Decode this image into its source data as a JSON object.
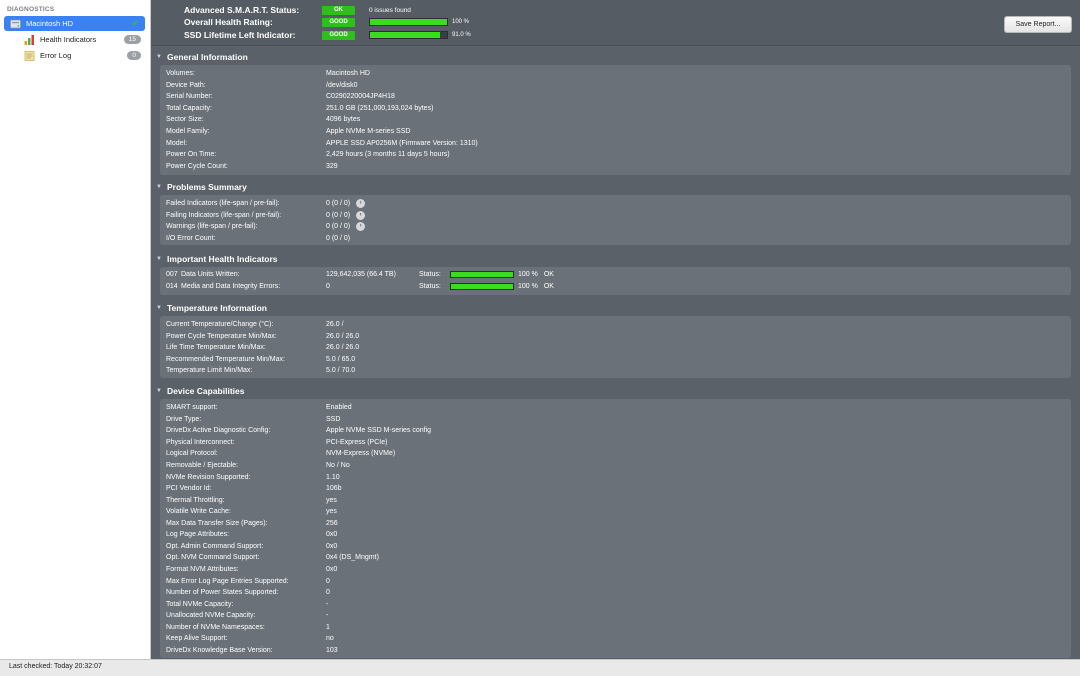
{
  "sidebar": {
    "heading": "DIAGNOSTICS",
    "items": [
      {
        "label": "Macintosh HD",
        "icon": "disk-icon",
        "selected": true
      },
      {
        "label": "Health Indicators",
        "icon": "bar-chart-icon",
        "count": "15"
      },
      {
        "label": "Error Log",
        "icon": "log-icon",
        "count": "0"
      }
    ]
  },
  "header": {
    "smart_label": "Advanced S.M.A.R.T. Status:",
    "smart_badge": "OK",
    "smart_text": "0 issues found",
    "health_label": "Overall Health Rating:",
    "health_badge": "GOOD",
    "health_value": "100 %",
    "health_fraction": 1.0,
    "ssd_label": "SSD Lifetime Left Indicator:",
    "ssd_badge": "GOOD",
    "ssd_value": "91.0 %",
    "ssd_fraction": 0.91,
    "save_button": "Save Report..."
  },
  "sections": {
    "general": {
      "title": "General Information",
      "rows": [
        {
          "label": "Volumes:",
          "value": "Macintosh HD"
        },
        {
          "label": "Device Path:",
          "value": "/dev/disk0"
        },
        {
          "label": "Serial Number:",
          "value": "C0290220004JP4H18"
        },
        {
          "label": "Total Capacity:",
          "value": "251.0 GB (251,000,193,024 bytes)"
        },
        {
          "label": "Sector Size:",
          "value": "4096 bytes"
        },
        {
          "label": "Model Family:",
          "value": "Apple NVMe M-series SSD"
        },
        {
          "label": "Model:",
          "value": "APPLE SSD AP0256M  (Firmware Version: 1310)"
        },
        {
          "label": "Power On Time:",
          "value": "2,429 hours (3 months 11 days 5 hours)"
        },
        {
          "label": "Power Cycle Count:",
          "value": "329"
        }
      ]
    },
    "problems": {
      "title": "Problems Summary",
      "rows": [
        {
          "label": "Failed Indicators (life-span / pre-fail):",
          "value": "0 (0 / 0)",
          "arrow": true
        },
        {
          "label": "Failing Indicators (life-span / pre-fail):",
          "value": "0 (0 / 0)",
          "arrow": true
        },
        {
          "label": "Warnings (life-span / pre-fail):",
          "value": "0 (0 / 0)",
          "arrow": true
        },
        {
          "label": "I/O Error Count:",
          "value": "0 (0 / 0)",
          "arrow": false
        }
      ]
    },
    "health": {
      "title": "Important Health Indicators",
      "rows": [
        {
          "code": "007",
          "name": "Data Units Written:",
          "value": "129,642,035 (66.4 TB)",
          "status_label": "Status:",
          "percent": "100 %",
          "fraction": 1.0,
          "result": "OK"
        },
        {
          "code": "014",
          "name": "Media and Data Integrity Errors:",
          "value": "0",
          "status_label": "Status:",
          "percent": "100 %",
          "fraction": 1.0,
          "result": "OK"
        }
      ]
    },
    "temperature": {
      "title": "Temperature Information",
      "rows": [
        {
          "label": "Current Temperature/Change (°C):",
          "value": "26.0 /"
        },
        {
          "label": "Power Cycle Temperature Min/Max:",
          "value": "26.0 / 26.0"
        },
        {
          "label": "Life Time Temperature Min/Max:",
          "value": "26.0 / 26.0"
        },
        {
          "label": "Recommended Temperature Min/Max:",
          "value": "5.0   / 65.0"
        },
        {
          "label": "Temperature Limit Min/Max:",
          "value": "5.0   / 70.0"
        }
      ]
    },
    "capabilities": {
      "title": "Device Capabilities",
      "rows": [
        {
          "label": "SMART support:",
          "value": "Enabled"
        },
        {
          "label": "Drive Type:",
          "value": "SSD"
        },
        {
          "label": "DriveDx Active Diagnostic Config:",
          "value": "Apple NVMe SSD M-series config"
        },
        {
          "label": "Physical Interconnect:",
          "value": "PCI-Express (PCIe)"
        },
        {
          "label": "Logical Protocol:",
          "value": "NVM-Express (NVMe)"
        },
        {
          "label": "Removable / Ejectable:",
          "value": "No / No"
        },
        {
          "label": "NVMe Revision Supported:",
          "value": "1.10"
        },
        {
          "label": "PCI Vendor Id:",
          "value": "106b"
        },
        {
          "label": "Thermal Throttling:",
          "value": "yes"
        },
        {
          "label": "Volatile Write Cache:",
          "value": "yes"
        },
        {
          "label": "Max Data Transfer Size (Pages):",
          "value": "256"
        },
        {
          "label": "Log Page Attributes:",
          "value": "0x0"
        },
        {
          "label": "Opt. Admin Command Support:",
          "value": "0x0"
        },
        {
          "label": "Opt. NVM Command Support:",
          "value": "0x4 (DS_Mngmt)"
        },
        {
          "label": "Format NVM Attributes:",
          "value": "0x0"
        },
        {
          "label": "Max Error Log Page Entries Supported:",
          "value": "0"
        },
        {
          "label": "Number of Power States Supported:",
          "value": "0"
        },
        {
          "label": "Total NVMe Capacity:",
          "value": "-"
        },
        {
          "label": "Unallocated NVMe Capacity:",
          "value": "-"
        },
        {
          "label": "Number of NVMe Namespaces:",
          "value": "1"
        },
        {
          "label": "Keep Alive Support:",
          "value": "no"
        },
        {
          "label": "DriveDx Knowledge Base Version:",
          "value": "103"
        }
      ]
    }
  },
  "footer": {
    "last_checked": "Last checked: Today 20:32:07"
  },
  "colors": {
    "accent": "#3a82f3",
    "good": "#2ec01a",
    "bar": "#39dd1e"
  }
}
